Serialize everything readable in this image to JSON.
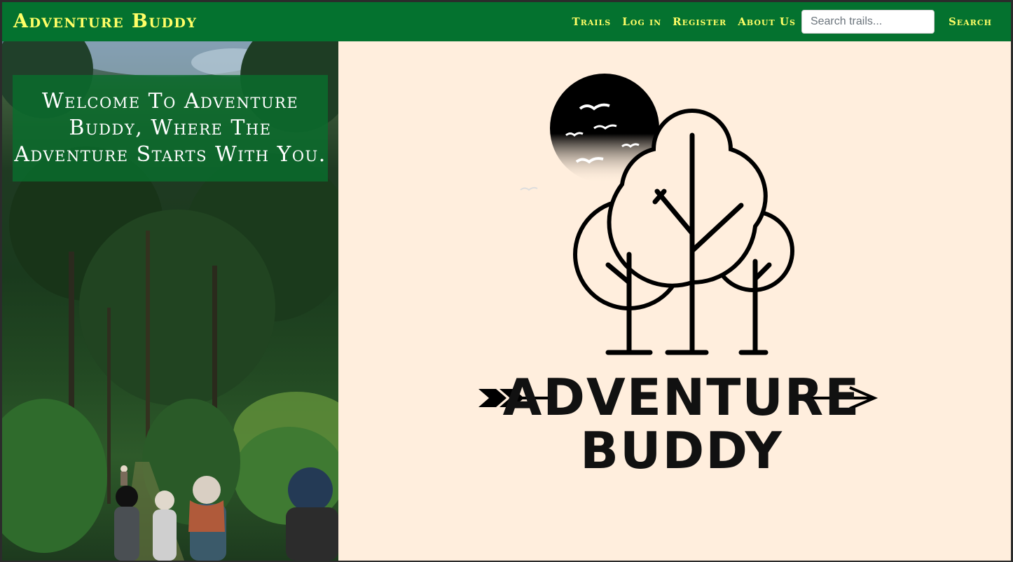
{
  "navbar": {
    "brand": "Adventure Buddy",
    "links": [
      "Trails",
      "Log in",
      "Register",
      "About Us"
    ],
    "search_placeholder": "Search trails...",
    "search_label": "Search"
  },
  "hero": {
    "welcome_text": "Welcome To Adventure Buddy, Where The Adventure Starts With You."
  },
  "logo": {
    "line1": "ADVENTURE",
    "line2": "BUDDY"
  },
  "colors": {
    "navbar_bg": "#04722f",
    "nav_text": "#ffff66",
    "page_bg": "#ffeedd",
    "welcome_box": "#0a6e2d"
  }
}
